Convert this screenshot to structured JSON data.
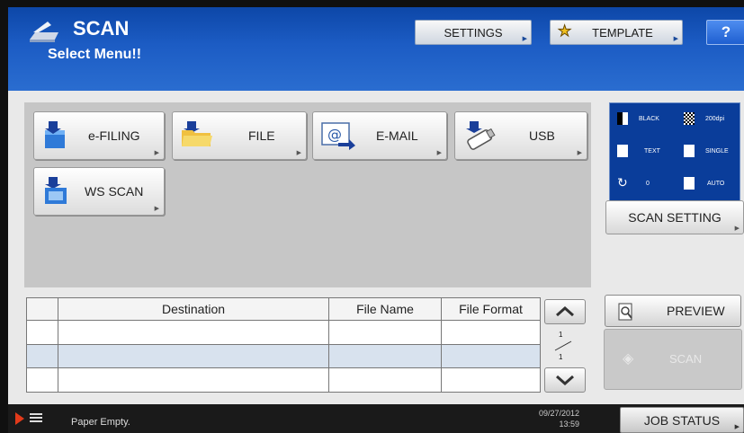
{
  "header": {
    "title": "SCAN",
    "subtitle": "Select Menu!!",
    "settings_label": "SETTINGS",
    "template_label": "TEMPLATE",
    "help_label": "?"
  },
  "functions": [
    {
      "label": "e-FILING",
      "icon": "efiling-icon"
    },
    {
      "label": "FILE",
      "icon": "folder-icon"
    },
    {
      "label": "E-MAIL",
      "icon": "email-icon"
    },
    {
      "label": "USB",
      "icon": "usb-icon"
    },
    {
      "label": "WS SCAN",
      "icon": "ws-scan-icon"
    }
  ],
  "scan_settings": {
    "color": "BLACK",
    "resolution": "200dpi",
    "original_mode": "TEXT",
    "duplex": "SINGLE",
    "rotation": "0",
    "size": "AUTO",
    "button_label": "SCAN SETTING"
  },
  "destination_table": {
    "headers": [
      "Destination",
      "File Name",
      "File Format"
    ],
    "rows": [
      [
        "",
        "",
        ""
      ],
      [
        "",
        "",
        ""
      ],
      [
        "",
        "",
        ""
      ]
    ]
  },
  "pager": {
    "current": "1",
    "total": "1"
  },
  "actions": {
    "preview_label": "PREVIEW",
    "scan_label": "SCAN"
  },
  "status": {
    "message": "Paper Empty.",
    "date": "09/27/2012",
    "time": "13:59",
    "job_status_label": "JOB STATUS"
  },
  "colors": {
    "header_blue": "#1c5cc4",
    "settings_panel": "#0a3d9a",
    "status_arrow": "#e23a1a"
  }
}
